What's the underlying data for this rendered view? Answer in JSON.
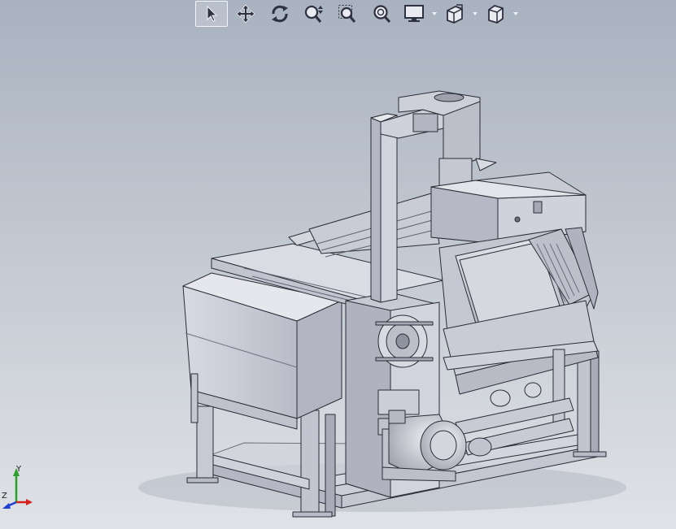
{
  "window": {
    "title": "",
    "background_top": "#a9b2c0",
    "background_bottom": "#dfe2e6"
  },
  "toolbar": {
    "items": [
      {
        "name": "select-tool",
        "icon": "cursor-arrow-icon",
        "active": true,
        "has_dropdown": false
      },
      {
        "name": "pan-tool",
        "icon": "move-arrows-icon",
        "active": false,
        "has_dropdown": false
      },
      {
        "name": "rotate-tool",
        "icon": "rotate-icon",
        "active": false,
        "has_dropdown": false
      },
      {
        "name": "zoom-in-out-tool",
        "icon": "zoom-in-out-icon",
        "active": false,
        "has_dropdown": false
      },
      {
        "name": "zoom-to-area-tool",
        "icon": "zoom-area-icon",
        "active": false,
        "has_dropdown": false
      },
      {
        "name": "zoom-to-fit-tool",
        "icon": "zoom-fit-icon",
        "active": false,
        "has_dropdown": false
      },
      {
        "name": "display-style-tool",
        "icon": "monitor-icon",
        "active": false,
        "has_dropdown": true
      },
      {
        "name": "view-orientation-tool",
        "icon": "view-orientation-icon",
        "active": false,
        "has_dropdown": true
      },
      {
        "name": "section-view-tool",
        "icon": "cube-icon",
        "active": false,
        "has_dropdown": true
      }
    ]
  },
  "model": {
    "description_icon": "machine-assembly-icon",
    "body_color": "#c9ccd6",
    "edge_color": "#2a2c35"
  },
  "triad": {
    "x_label": "",
    "y_label": "Y",
    "z_label": "Z",
    "x_color": "#d62020",
    "y_color": "#2aa02a",
    "z_color": "#2040d0"
  }
}
